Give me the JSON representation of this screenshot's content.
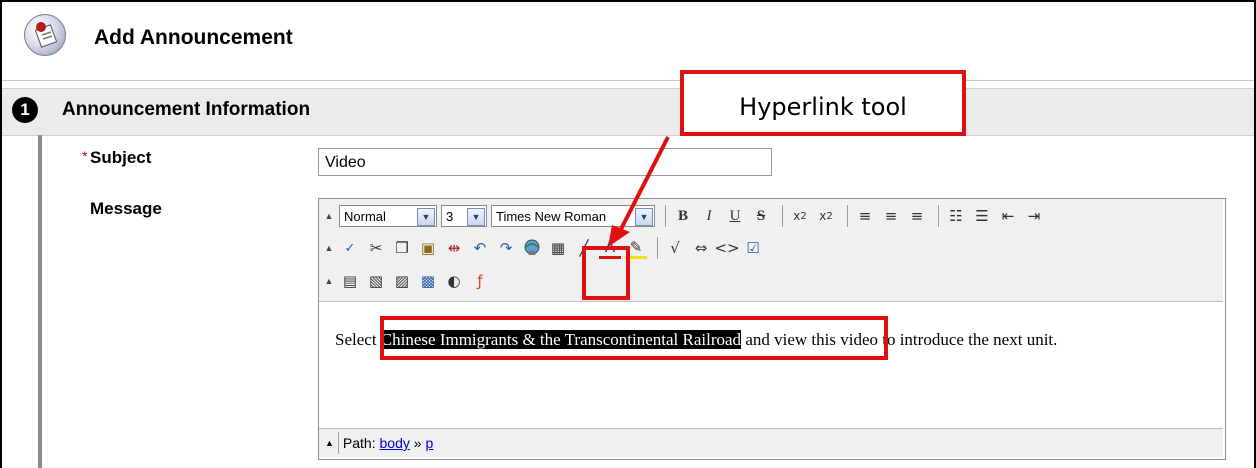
{
  "header": {
    "title": "Add Announcement",
    "icon": "announcement-icon"
  },
  "section": {
    "step": "1",
    "title": "Announcement Information"
  },
  "form": {
    "required_marker": "*",
    "subject_label": "Subject",
    "subject_value": "Video",
    "message_label": "Message"
  },
  "toolbar": {
    "style_value": "Normal",
    "size_value": "3",
    "font_value": "Times New Roman",
    "bold": "B",
    "italic": "I",
    "underline": "U",
    "strike": "S"
  },
  "message": {
    "before": "Select ",
    "selected": "Chinese Immigrants & the Transcontinental Railroad",
    "after": " and view this video to introduce the next unit."
  },
  "pathbar": {
    "label": "Path:",
    "body": "body",
    "separator": "»",
    "p": "p"
  },
  "annotation": {
    "callout": "Hyperlink tool",
    "color": "#e01010"
  }
}
